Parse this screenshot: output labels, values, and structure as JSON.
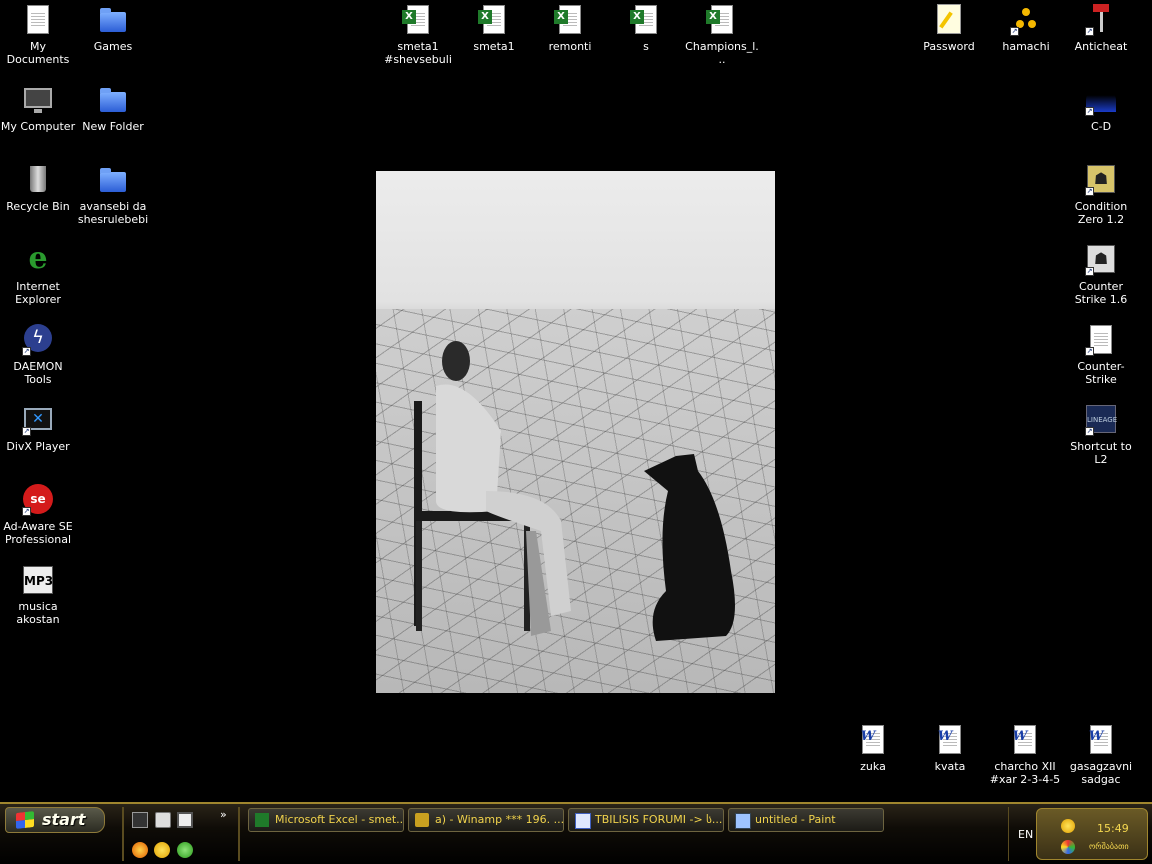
{
  "desktop": {
    "icons_left": [
      {
        "label": "My Documents",
        "icon": "my-documents-icon"
      },
      {
        "label": "My Computer",
        "icon": "my-computer-icon"
      },
      {
        "label": "Recycle Bin",
        "icon": "recycle-bin-icon"
      },
      {
        "label": "Internet Explorer",
        "icon": "internet-explorer-icon"
      },
      {
        "label": "DAEMON Tools",
        "icon": "daemon-tools-icon"
      },
      {
        "label": "DivX Player",
        "icon": "divx-player-icon"
      },
      {
        "label": "Ad-Aware SE Professional",
        "icon": "ad-aware-icon"
      },
      {
        "label": "musica akostan",
        "icon": "mp3-folder-icon"
      }
    ],
    "icons_col2": [
      {
        "label": "Games",
        "icon": "folder-icon"
      },
      {
        "label": "New Folder",
        "icon": "folder-icon"
      },
      {
        "label": "avansebi da shesrulebebi",
        "icon": "folder-icon"
      }
    ],
    "icons_top": [
      {
        "label": "smeta1 #shevsebuli",
        "icon": "excel-file-icon"
      },
      {
        "label": "smeta1",
        "icon": "excel-file-icon"
      },
      {
        "label": "remonti",
        "icon": "excel-file-icon"
      },
      {
        "label": "s",
        "icon": "excel-file-icon"
      },
      {
        "label": "Champions_l...",
        "icon": "excel-file-icon"
      }
    ],
    "icons_top_right": [
      {
        "label": "Password",
        "icon": "notepad-icon"
      },
      {
        "label": "hamachi",
        "icon": "hamachi-icon"
      },
      {
        "label": "Anticheat",
        "icon": "anticheat-icon"
      }
    ],
    "icons_right": [
      {
        "label": "C-D",
        "icon": "cd-icon"
      },
      {
        "label": "Condition Zero 1.2",
        "icon": "counter-strike-cz-icon"
      },
      {
        "label": "Counter Strike 1.6",
        "icon": "counter-strike-icon"
      },
      {
        "label": "Counter-Strike",
        "icon": "blank-document-icon"
      },
      {
        "label": "Shortcut to L2",
        "icon": "lineage2-icon"
      }
    ],
    "icons_bottom": [
      {
        "label": "zuka",
        "icon": "word-document-icon"
      },
      {
        "label": "kvata",
        "icon": "word-document-icon"
      },
      {
        "label": "charcho XII #xar 2-3-4-5",
        "icon": "word-document-icon"
      },
      {
        "label": "gasagzavni sadgac",
        "icon": "word-document-icon"
      }
    ]
  },
  "taskbar": {
    "start_label": "start",
    "quick_launch_more": "»",
    "tasks": [
      {
        "label": "Microsoft Excel - smet...",
        "icon": "excel-icon"
      },
      {
        "label": "a) - Winamp *** 196. ...",
        "icon": "winamp-icon"
      },
      {
        "label": "TBILISIS FORUMI -> ს...",
        "icon": "browser-window-icon"
      },
      {
        "label": "untitled - Paint",
        "icon": "paint-icon"
      }
    ],
    "language": "EN",
    "clock": "15:49",
    "tray_day": "ორშაბათი"
  }
}
